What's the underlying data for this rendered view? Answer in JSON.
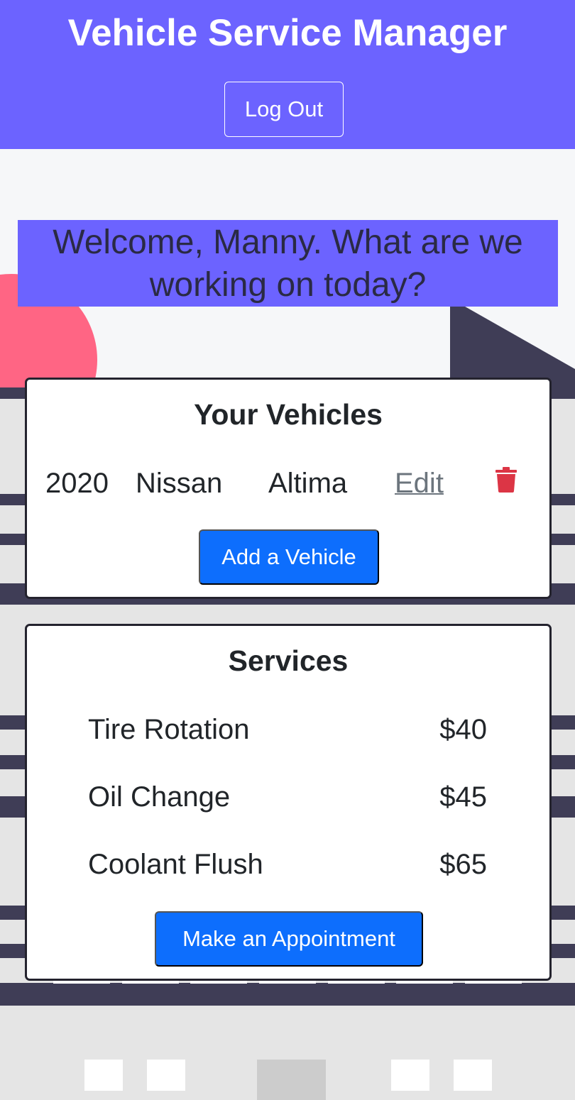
{
  "header": {
    "title": "Vehicle Service Manager",
    "logout_label": "Log Out"
  },
  "welcome": {
    "line1": "Welcome, Manny. What are we",
    "line2": "working on today?"
  },
  "vehicles": {
    "title": "Your Vehicles",
    "items": [
      {
        "year": "2020",
        "make": "Nissan",
        "model": "Altima",
        "edit_label": "Edit",
        "delete_icon": "trash-icon"
      }
    ],
    "add_label": "Add a Vehicle"
  },
  "services": {
    "title": "Services",
    "items": [
      {
        "name": "Tire Rotation",
        "price": "$40"
      },
      {
        "name": "Oil Change",
        "price": "$45"
      },
      {
        "name": "Coolant Flush",
        "price": "$65"
      }
    ],
    "appointment_label": "Make an Appointment"
  },
  "colors": {
    "header": "#6c63ff",
    "primary_button": "#0d6efd",
    "delete_icon": "#dc3545",
    "accent_pink": "#ff6584",
    "dark": "#3f3d56"
  }
}
